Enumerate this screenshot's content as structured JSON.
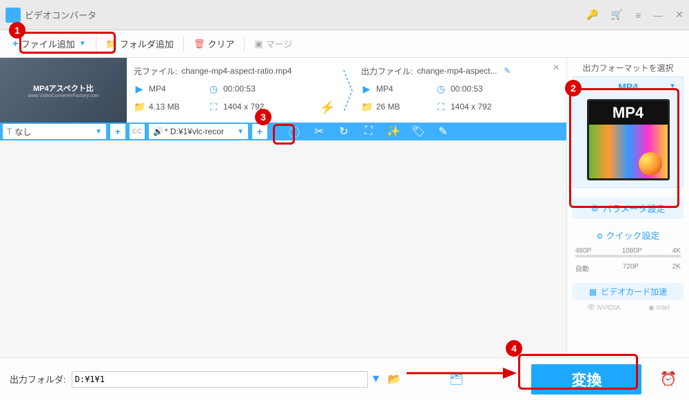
{
  "title": "ビデオコンバータ",
  "toolbar": {
    "add_file": "ファイル追加",
    "add_folder": "フォルダ追加",
    "clear": "クリア",
    "merge": "マージ"
  },
  "item": {
    "source_label": "元ファイル:",
    "source_name": "change-mp4-aspect-ratio.mp4",
    "source_format": "MP4",
    "source_duration": "00:00:53",
    "source_size": "4.13 MB",
    "source_dims": "1404 x 792",
    "output_label": "出力ファイル:",
    "output_name": "change-mp4-aspect...",
    "output_format": "MP4",
    "output_duration": "00:00:53",
    "output_size": "26 MB",
    "output_dims": "1404 x 792",
    "thumb_main": "MP4アスペクト比",
    "thumb_sub": "www.VideoConverterFactory.com",
    "sub_none": "なし",
    "audio_path": "* D:¥1¥vlc-recor",
    "cc_label": "CC"
  },
  "right": {
    "title": "出力フォーマットを選択",
    "format": "MP4",
    "format_img_label": "MP4",
    "param": "パラメータ設定",
    "quick": "クイック設定",
    "res": {
      "p480": "480P",
      "p720": "720P",
      "p1080": "1080P",
      "p2k": "2K",
      "p4k": "4K",
      "auto": "自動"
    },
    "gpu": "ビデオカード加速",
    "nvidia": "NVIDIA",
    "intel": "Intel"
  },
  "bottom": {
    "label": "出力フォルダ:",
    "path": "D:¥1¥1",
    "convert": "変換"
  },
  "badges": {
    "b1": "1",
    "b2": "2",
    "b3": "3",
    "b4": "4"
  }
}
